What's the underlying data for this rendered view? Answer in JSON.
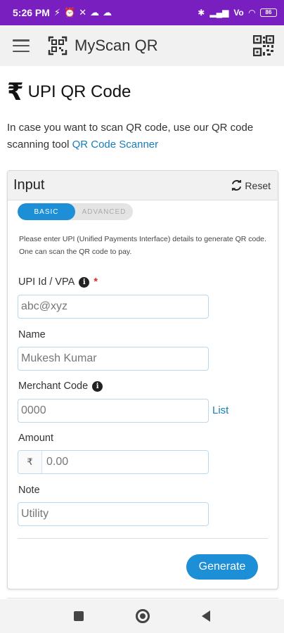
{
  "status_bar": {
    "time": "5:26 PM",
    "left_icons": [
      "⚡",
      "⏰",
      "✕",
      "☁",
      "☁"
    ],
    "right_icons": [
      "✱",
      "▂▄▆",
      "Vo",
      "◠"
    ],
    "battery": "86"
  },
  "app_bar": {
    "title": "MyScan QR"
  },
  "page": {
    "currency_symbol": "₹",
    "title": "UPI QR Code",
    "intro_text": "In case you want to scan QR code, use our QR code scanning tool ",
    "intro_link": "QR Code Scanner"
  },
  "card": {
    "title": "Input",
    "reset_label": "Reset",
    "modes": [
      "BASIC",
      "ADVANCED"
    ],
    "active_mode": "BASIC",
    "help_text": "Please enter UPI (Unified Payments Interface) details to generate QR code. One can scan the QR code to pay.",
    "fields": {
      "upi": {
        "label": "UPI Id / VPA",
        "required_mark": "*",
        "placeholder": "abc@xyz"
      },
      "name": {
        "label": "Name",
        "placeholder": "Mukesh Kumar"
      },
      "merchant": {
        "label": "Merchant Code",
        "placeholder": "0000",
        "list_label": "List"
      },
      "amount": {
        "label": "Amount",
        "prefix": "₹",
        "placeholder": "0.00"
      },
      "note": {
        "label": "Note",
        "placeholder": "Utility"
      }
    },
    "generate_label": "Generate"
  },
  "colors": {
    "status_bar": "#7a1fbf",
    "accent": "#1c8fd6",
    "link": "#1a7bb8"
  }
}
